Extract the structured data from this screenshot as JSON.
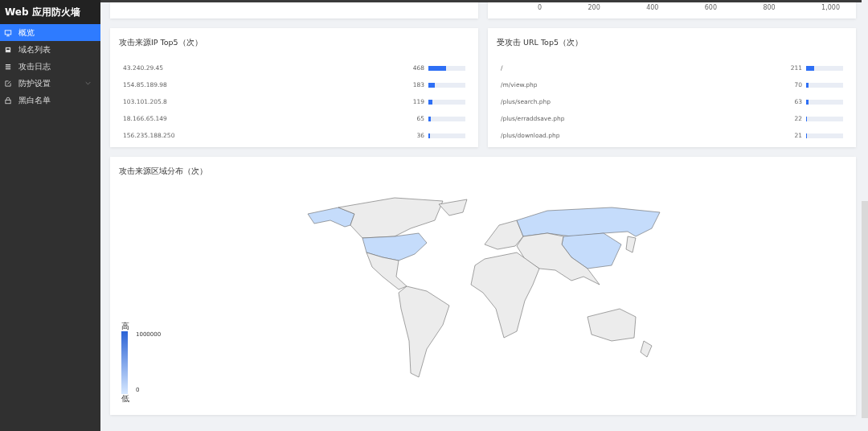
{
  "sidebar": {
    "title": "Web 应用防火墙",
    "items": [
      {
        "label": "概览",
        "kind": "monitor",
        "selected": true,
        "expandable": false
      },
      {
        "label": "域名列表",
        "kind": "card",
        "selected": false,
        "expandable": false
      },
      {
        "label": "攻击日志",
        "kind": "list",
        "selected": false,
        "expandable": false
      },
      {
        "label": "防护设置",
        "kind": "edit",
        "selected": false,
        "expandable": true
      },
      {
        "label": "黑白名单",
        "kind": "lock",
        "selected": false,
        "expandable": false
      }
    ]
  },
  "top_right_card": {
    "axis_ticks": [
      "0",
      "200",
      "400",
      "600",
      "800",
      "1,000"
    ]
  },
  "ip_top5": {
    "title": "攻击来源IP Top5（次）",
    "rows": [
      {
        "name": "43.240.29.45",
        "count": "468",
        "level": 0.468
      },
      {
        "name": "154.85.189.98",
        "count": "183",
        "level": 0.183
      },
      {
        "name": "103.101.205.8",
        "count": "119",
        "level": 0.119
      },
      {
        "name": "18.166.65.149",
        "count": "65",
        "level": 0.065
      },
      {
        "name": "156.235.188.250",
        "count": "36",
        "level": 0.036
      }
    ]
  },
  "url_top5": {
    "title": "受攻击 URL Top5（次）",
    "rows": [
      {
        "name": "/",
        "count": "211",
        "level": 0.211
      },
      {
        "name": "/m/view.php",
        "count": "70",
        "level": 0.07
      },
      {
        "name": "/plus/search.php",
        "count": "63",
        "level": 0.063
      },
      {
        "name": "/plus/erraddsave.php",
        "count": "22",
        "level": 0.022
      },
      {
        "name": "/plus/download.php",
        "count": "21",
        "level": 0.021
      }
    ]
  },
  "region_map": {
    "title": "攻击来源区域分布（次）",
    "legend": {
      "high_label": "高",
      "max": "1000000",
      "low_label": "低",
      "min": "0"
    }
  }
}
